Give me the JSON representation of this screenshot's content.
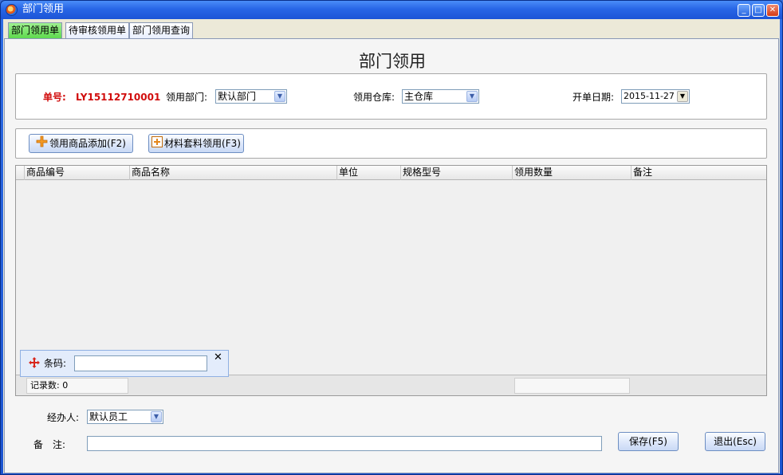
{
  "window": {
    "title": "部门领用",
    "controls": {
      "minimize": "_",
      "maximize": "□",
      "close": "✕"
    }
  },
  "tabs": [
    {
      "label": "部门领用单",
      "active": true
    },
    {
      "label": "待审核领用单",
      "active": false
    },
    {
      "label": "部门领用查询",
      "active": false
    }
  ],
  "page_title": "部门领用",
  "header": {
    "order_no_label": "单号:",
    "order_no": "LY15112710001",
    "dept_label": "领用部门:",
    "dept_value": "默认部门",
    "warehouse_label": "领用仓库:",
    "warehouse_value": "主仓库",
    "date_label": "开单日期:",
    "date_value": "2015-11-27"
  },
  "toolbar": {
    "add_goods": "领用商品添加(F2)",
    "kit_use": "材料套料领用(F3)"
  },
  "grid": {
    "columns": [
      "商品编号",
      "商品名称",
      "单位",
      "规格型号",
      "领用数量",
      "备注"
    ],
    "record_count_label": "记录数: 0"
  },
  "barcode": {
    "label": "条码:",
    "value": "",
    "close": "✕"
  },
  "footer": {
    "handler_label": "经办人:",
    "handler_value": "默认员工",
    "remark_label": "备　注:",
    "remark_value": "",
    "save_label": "保存(F5)",
    "exit_label": "退出(Esc)"
  },
  "colors": {
    "order_no": "#d10d0d",
    "active_tab": "#6ee05a",
    "titlebar": "#2866e6"
  }
}
